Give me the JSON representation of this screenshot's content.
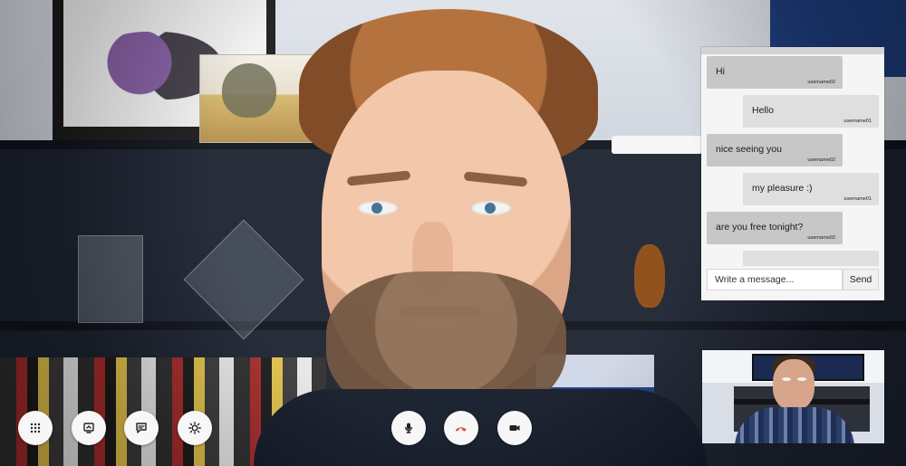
{
  "controls": {
    "left": [
      {
        "name": "dialpad-icon"
      },
      {
        "name": "screen-share-icon"
      },
      {
        "name": "chat-icon"
      },
      {
        "name": "settings-icon"
      }
    ],
    "center": [
      {
        "name": "microphone-icon"
      },
      {
        "name": "end-call-icon"
      },
      {
        "name": "camera-icon"
      }
    ]
  },
  "chat": {
    "messages": [
      {
        "side": "left",
        "text": "Hi",
        "user": "username02"
      },
      {
        "side": "right",
        "text": "Hello",
        "user": "username01"
      },
      {
        "side": "left",
        "text": "nice seeing you",
        "user": "username02"
      },
      {
        "side": "right",
        "text": "my pleasure :)",
        "user": "username01"
      },
      {
        "side": "left",
        "text": "are you free tonight?",
        "user": "username02"
      },
      {
        "side": "right",
        "text": "",
        "user": ""
      }
    ],
    "input_placeholder": "Write a message...",
    "send_label": "Send"
  },
  "colors": {
    "end_call_red": "#d9534f",
    "button_bg": "#f7f7f7",
    "chat_bubble_left": "#c7c7c7",
    "chat_bubble_right": "#dfdfdf"
  }
}
